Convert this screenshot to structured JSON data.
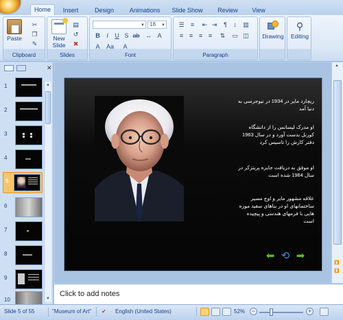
{
  "ribbon": {
    "tabs": [
      "Home",
      "Insert",
      "Design",
      "Animations",
      "Slide Show",
      "Review",
      "View"
    ],
    "groups": {
      "clipboard": "Clipboard",
      "slides": "Slides",
      "font": "Font",
      "paragraph": "Paragraph",
      "drawing": "Drawing",
      "editing": "Editing"
    },
    "paste_label": "Paste",
    "new_slide_label": "New Slide",
    "font_size_value": "18",
    "drawing_label": "Drawing",
    "editing_label": "Editing"
  },
  "slide_pane": {
    "thumbnails": [
      "1",
      "2",
      "3",
      "4",
      "5",
      "6",
      "7",
      "8",
      "9",
      "10"
    ],
    "selected": "5"
  },
  "slide": {
    "paragraphs": [
      "ریچارد مایر در 1934 در نیوجرسی به دنیا آمد",
      "او مدرک لیسانس را از دانشگاه کورنل بدست آورد و در سال 1963 دفتر کارش را تاسیس کرد",
      "او موفق به دریافت جایزه پریتزکر در سال 1984 شده است",
      "علاقه مشهور مایر و اوج مسیر ساختمانهای او در بناهای سفید موزه هایی با فرمهای هندسی و پیچیده است"
    ]
  },
  "notes": {
    "placeholder": "Click to add notes"
  },
  "status_bar": {
    "slide_info": "Slide 5 of 55",
    "theme": "\"Museum of Art\"",
    "language": "English (United States)",
    "zoom": "52%"
  },
  "colors": {
    "ribbon": "#dce8f6",
    "slide_background": "#050505",
    "selected_thumbnail": "#f8c46a",
    "nav_arrows": "#5fb820"
  },
  "icons": [
    "office-logo-icon",
    "paste-icon",
    "new-slide-icon",
    "bold-icon",
    "drawing-icon",
    "editing-icon",
    "prev-arrow-icon",
    "replay-icon",
    "next-arrow-icon",
    "spell-check-icon",
    "normal-view-icon",
    "sorter-view-icon",
    "slideshow-view-icon",
    "fit-window-icon"
  ]
}
